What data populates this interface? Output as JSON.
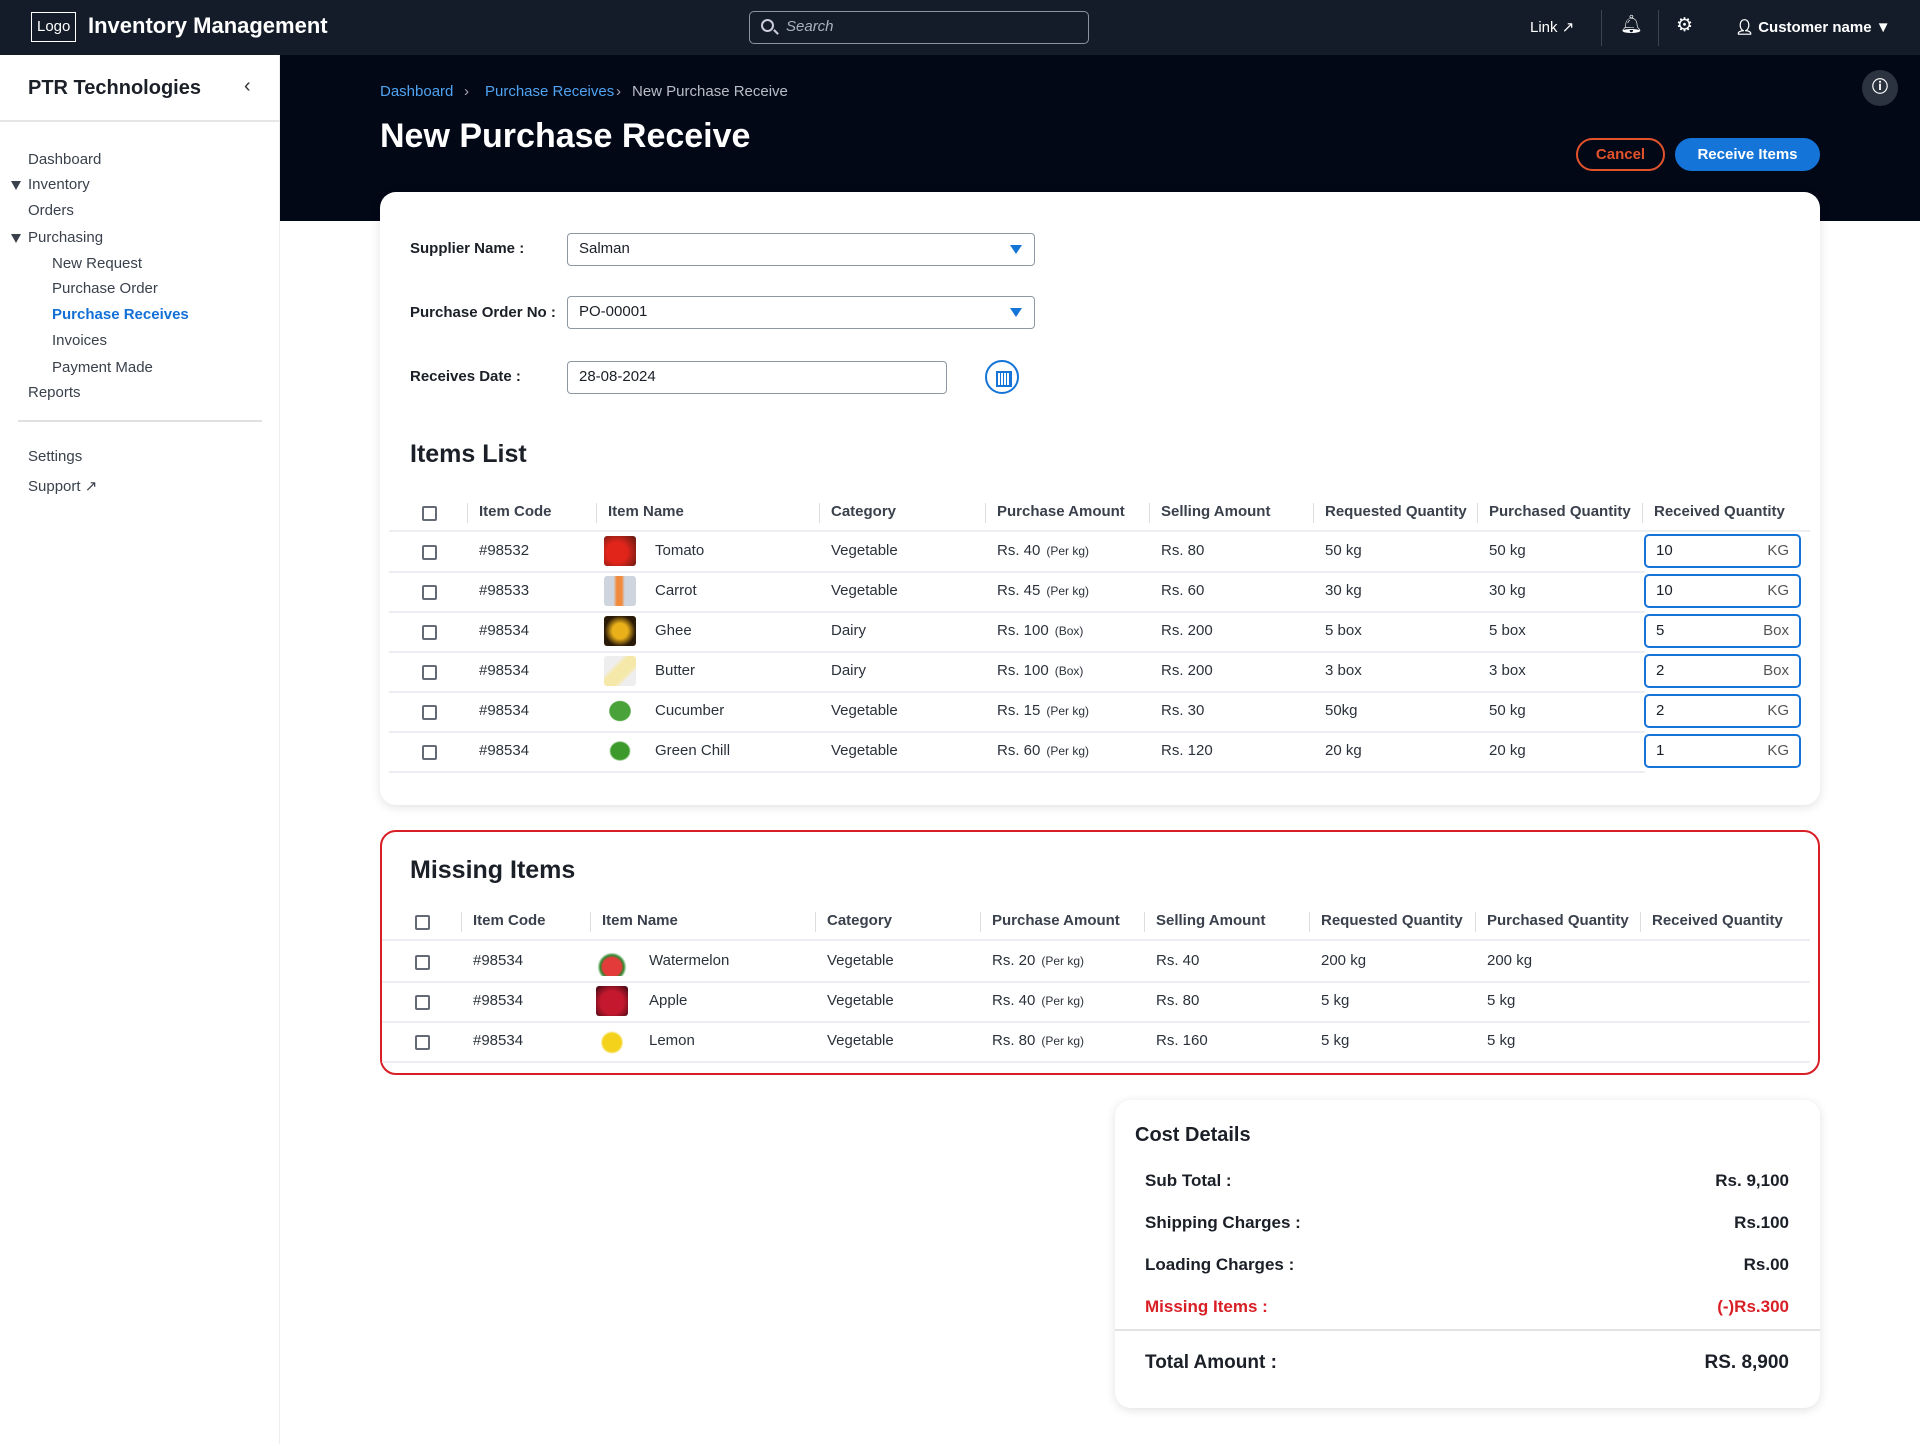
{
  "header": {
    "logo": "Logo",
    "title": "Inventory Management",
    "search_placeholder": "Search",
    "link": "Link",
    "user": "Customer name"
  },
  "sidebar": {
    "company": "PTR Technologies",
    "items": [
      {
        "label": "Dashboard",
        "level": 0
      },
      {
        "label": "Inventory",
        "level": 0,
        "expanded": true
      },
      {
        "label": "Orders",
        "level": 0
      },
      {
        "label": "Purchasing",
        "level": 0,
        "expanded": true
      },
      {
        "label": "New Request",
        "level": 1
      },
      {
        "label": "Purchase Order",
        "level": 1
      },
      {
        "label": "Purchase Receives",
        "level": 1,
        "active": true
      },
      {
        "label": "Invoices",
        "level": 1
      },
      {
        "label": "Payment Made",
        "level": 1
      },
      {
        "label": "Reports",
        "level": 0
      }
    ],
    "settings": "Settings",
    "support": "Support"
  },
  "breadcrumb": [
    "Dashboard",
    "Purchase Receives",
    "New Purchase Receive"
  ],
  "page": {
    "title": "New Purchase Receive",
    "cancel": "Cancel",
    "receive": "Receive Items"
  },
  "form": {
    "supplier_label": "Supplier Name :",
    "supplier_value": "Salman",
    "po_label": "Purchase Order No :",
    "po_value": "PO-00001",
    "date_label": "Receives Date :",
    "date_value": "28-08-2024"
  },
  "items": {
    "title": "Items List",
    "columns": [
      "Item Code",
      "Item Name",
      "Category",
      "Purchase Amount",
      "Selling Amount",
      "Requested Quantity",
      "Purchased Quantity",
      "Received Quantity"
    ],
    "rows": [
      {
        "code": "#98532",
        "name": "Tomato",
        "image": "tomato",
        "category": "Vegetable",
        "purchase": "Rs. 40",
        "unit_note": "(Per kg)",
        "selling": "Rs. 80",
        "requested": "50 kg",
        "purchased": "50 kg",
        "received": "10",
        "received_unit": "KG"
      },
      {
        "code": "#98533",
        "name": "Carrot",
        "image": "carrot",
        "category": "Vegetable",
        "purchase": "Rs. 45",
        "unit_note": "(Per kg)",
        "selling": "Rs. 60",
        "requested": "30 kg",
        "purchased": "30 kg",
        "received": "10",
        "received_unit": "KG"
      },
      {
        "code": "#98534",
        "name": "Ghee",
        "image": "ghee",
        "category": "Dairy",
        "purchase": "Rs. 100",
        "unit_note": "(Box)",
        "selling": "Rs. 200",
        "requested": "5 box",
        "purchased": "5 box",
        "received": "5",
        "received_unit": "Box"
      },
      {
        "code": "#98534",
        "name": "Butter",
        "image": "butter",
        "category": "Dairy",
        "purchase": "Rs. 100",
        "unit_note": "(Box)",
        "selling": "Rs. 200",
        "requested": "3 box",
        "purchased": "3 box",
        "received": "2",
        "received_unit": "Box"
      },
      {
        "code": "#98534",
        "name": "Cucumber",
        "image": "cucumber",
        "category": "Vegetable",
        "purchase": "Rs. 15",
        "unit_note": "(Per kg)",
        "selling": "Rs. 30",
        "requested": "50kg",
        "purchased": "50 kg",
        "received": "2",
        "received_unit": "KG"
      },
      {
        "code": "#98534",
        "name": "Green Chill",
        "image": "green-chilli",
        "category": "Vegetable",
        "purchase": "Rs. 60",
        "unit_note": "(Per kg)",
        "selling": "Rs. 120",
        "requested": "20 kg",
        "purchased": "20 kg",
        "received": "1",
        "received_unit": "KG"
      }
    ]
  },
  "missing": {
    "title": "Missing Items",
    "columns": [
      "Item Code",
      "Item Name",
      "Category",
      "Purchase Amount",
      "Selling Amount",
      "Requested Quantity",
      "Purchased Quantity",
      "Received Quantity"
    ],
    "rows": [
      {
        "code": "#98534",
        "name": "Watermelon",
        "image": "watermelon",
        "category": "Vegetable",
        "purchase": "Rs. 20",
        "unit_note": "(Per kg)",
        "selling": "Rs. 40",
        "requested": "200 kg",
        "purchased": "200 kg"
      },
      {
        "code": "#98534",
        "name": "Apple",
        "image": "apple",
        "category": "Vegetable",
        "purchase": "Rs. 40",
        "unit_note": "(Per kg)",
        "selling": "Rs. 80",
        "requested": "5 kg",
        "purchased": "5 kg"
      },
      {
        "code": "#98534",
        "name": "Lemon",
        "image": "lemon",
        "category": "Vegetable",
        "purchase": "Rs. 80",
        "unit_note": "(Per kg)",
        "selling": "Rs. 160",
        "requested": "5 kg",
        "purchased": "5 kg"
      }
    ]
  },
  "cost": {
    "title": "Cost Details",
    "sub_total_label": "Sub Total :",
    "sub_total": "Rs. 9,100",
    "shipping_label": "Shipping Charges :",
    "shipping": "Rs.100",
    "loading_label": "Loading Charges :",
    "loading": "Rs.00",
    "missing_label": "Missing Items :",
    "missing": "(-)Rs.300",
    "total_label": "Total Amount :",
    "total": "RS. 8,900"
  },
  "colors": {
    "accent": "#1474d8",
    "danger": "#d91f26",
    "cancel": "#e2532c",
    "topbar": "#141c2a"
  }
}
